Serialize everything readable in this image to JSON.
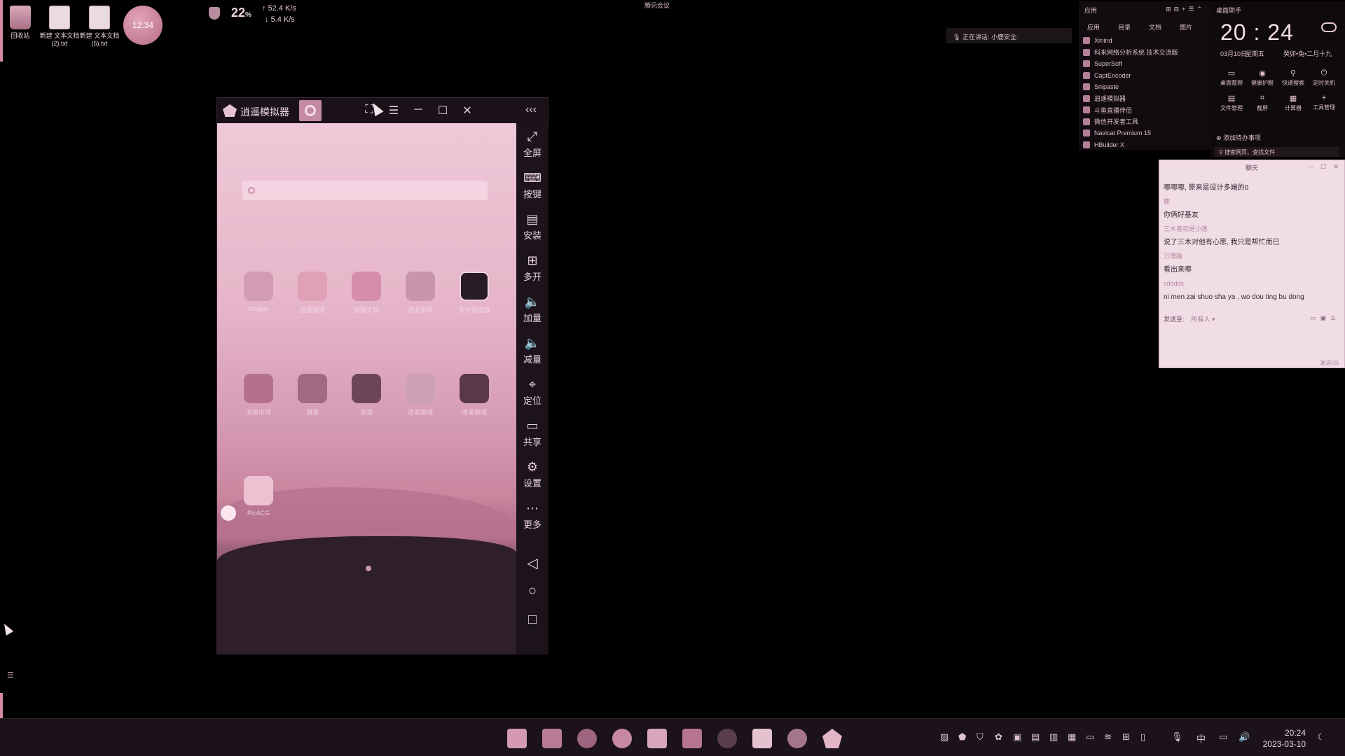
{
  "desktop": {
    "icons": [
      {
        "label": "回收站",
        "icon": "recycle-bin-icon"
      },
      {
        "label": "新建 文本文档 (2).txt",
        "icon": "text-file-icon"
      },
      {
        "label": "新建 文本文档 (5).txt",
        "icon": "text-file-icon"
      }
    ],
    "clock_bubble": "12:34"
  },
  "net_widget": {
    "value": "22",
    "unit": "%",
    "upload": "52.4 K/s",
    "download": "5.4 K/s"
  },
  "meeting_bar": "腾讯会议",
  "speaking_bar": "正在讲话: 小鹿安全:",
  "emulator": {
    "title": "逍遥模拟器",
    "titlebar_buttons": [
      "⛶",
      "☰",
      "─",
      "☐",
      "✕",
      "‹‹‹"
    ],
    "apps_row1": [
      "Magisk",
      "逍遥游戏",
      "拍照工具",
      "逍遥市场",
      "文件管理器"
    ],
    "apps_row2": [
      "逍遥市场",
      "逍遥",
      "逍遥",
      "逍遥游戏",
      "逍遥游戏"
    ],
    "apps_row3": [
      "PicACG"
    ],
    "sidebar": [
      {
        "label": "全屏",
        "icon": "fullscreen-icon",
        "glyph": "⤢"
      },
      {
        "label": "按键",
        "icon": "keyboard-icon",
        "glyph": "⌨"
      },
      {
        "label": "安装",
        "icon": "apk-install-icon",
        "glyph": "▤"
      },
      {
        "label": "多开",
        "icon": "multi-instance-icon",
        "glyph": "⊞"
      },
      {
        "label": "加量",
        "icon": "volume-up-icon",
        "glyph": "🔈"
      },
      {
        "label": "减量",
        "icon": "volume-down-icon",
        "glyph": "🔈"
      },
      {
        "label": "定位",
        "icon": "location-icon",
        "glyph": "⌖"
      },
      {
        "label": "共享",
        "icon": "folder-share-icon",
        "glyph": "▭"
      },
      {
        "label": "设置",
        "icon": "settings-icon",
        "glyph": "⚙"
      },
      {
        "label": "更多",
        "icon": "more-icon",
        "glyph": "⋯"
      }
    ],
    "nav": [
      "◁",
      "○",
      "□"
    ]
  },
  "app_list": {
    "header": "应用",
    "tabs": [
      "应用",
      "目录",
      "文档",
      "图片"
    ],
    "items": [
      "Xmind",
      "科来网络分析系统 技术交流版",
      "SuperSoft",
      "CaptEncoder",
      "Snipaste",
      "逍遥模拟器",
      "斗鱼直播伴侣",
      "微信开发者工具",
      "Navicat Premium 15",
      "HBuilder X"
    ]
  },
  "assistant": {
    "header": "桌面助手",
    "time": "20 : 24",
    "date": "03月10日",
    "weekday": "星期五",
    "lunar": "癸卯•兔•二月十九",
    "actions": [
      "桌面整理",
      "健康护眼",
      "快速搜索",
      "定时关机",
      "文件管理",
      "截屏",
      "计算器",
      "工具管理"
    ],
    "todo": "添加待办事项",
    "search": "搜索网页、查找文件"
  },
  "chat": {
    "title": "聊天",
    "messages": [
      {
        "text": "哪哪哪, 原来是设计多端的0",
        "kind": "msg"
      },
      {
        "text": "鹿",
        "kind": "who"
      },
      {
        "text": "你俩好基友",
        "kind": "msg"
      },
      {
        "text": "三木喜欢是小莲",
        "kind": "who"
      },
      {
        "text": "说了三木对他有心思, 我只是帮忙而已",
        "kind": "msg"
      },
      {
        "text": "万博融",
        "kind": "who"
      },
      {
        "text": "看出来哪",
        "kind": "msg"
      },
      {
        "text": "sdddds",
        "kind": "who"
      },
      {
        "text": "ni men zai shuo sha ya , wo dou ting bu dong",
        "kind": "msg"
      }
    ],
    "send_to_label": "发送至:",
    "send_to_value": "所有人 ▾",
    "send_button": "发送(S)"
  },
  "taskbar": {
    "clock_time": "20:24",
    "clock_date": "2023-03-10",
    "ime": "中"
  }
}
